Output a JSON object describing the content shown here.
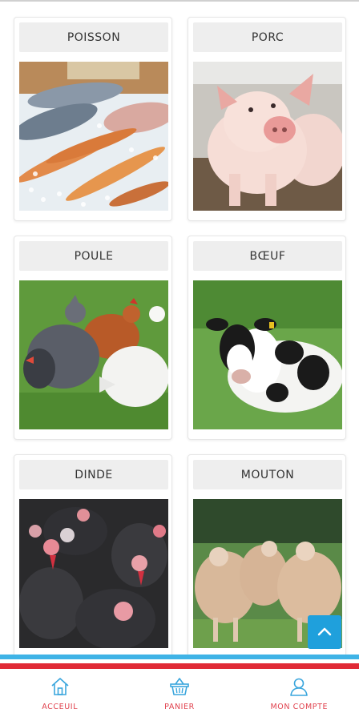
{
  "categories": [
    {
      "label": "POISSON",
      "image": "fish-on-ice"
    },
    {
      "label": "PORC",
      "image": "pigs"
    },
    {
      "label": "POULE",
      "image": "hens"
    },
    {
      "label": "BŒUF",
      "image": "cow"
    },
    {
      "label": "DINDE",
      "image": "turkeys"
    },
    {
      "label": "MOUTON",
      "image": "sheep"
    }
  ],
  "scroll_top": {
    "icon": "chevron-up-icon"
  },
  "bottom_nav": [
    {
      "label": "ACCEUIL",
      "icon": "home-icon"
    },
    {
      "label": "PANIER",
      "icon": "basket-icon"
    },
    {
      "label": "MON COMPTE",
      "icon": "user-icon"
    }
  ],
  "colors": {
    "accent_blue": "#1fa0dc",
    "stripe_blue": "#3fb3e6",
    "stripe_red": "#e02a36",
    "nav_label": "#e0424e",
    "nav_icon": "#3aa6dd"
  }
}
